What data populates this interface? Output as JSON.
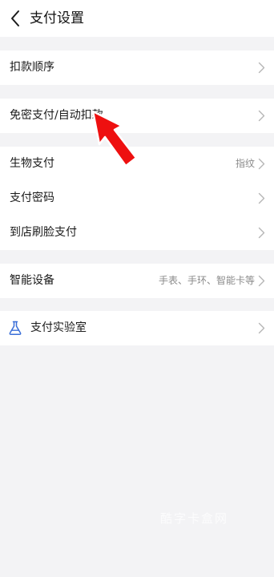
{
  "header": {
    "title": "支付设置"
  },
  "groups": [
    {
      "items": [
        {
          "label": "扣款顺序",
          "value": ""
        }
      ]
    },
    {
      "items": [
        {
          "label": "免密支付/自动扣款",
          "value": ""
        }
      ]
    },
    {
      "items": [
        {
          "label": "生物支付",
          "value": "指纹"
        },
        {
          "label": "支付密码",
          "value": ""
        },
        {
          "label": "到店刷脸支付",
          "value": ""
        }
      ]
    },
    {
      "items": [
        {
          "label": "智能设备",
          "value": "手表、手环、智能卡等"
        }
      ]
    },
    {
      "items": [
        {
          "label": "支付实验室",
          "value": "",
          "icon": "flask-icon"
        }
      ]
    }
  ],
  "annotation": {
    "color": "#ee1010",
    "icon": "red-arrow-icon"
  },
  "watermark": "酷字卡盒网",
  "colors": {
    "background": "#f3f3f5",
    "card": "#ffffff",
    "icon_accent": "#3a6fd8",
    "value_text": "#8a8a8a"
  }
}
